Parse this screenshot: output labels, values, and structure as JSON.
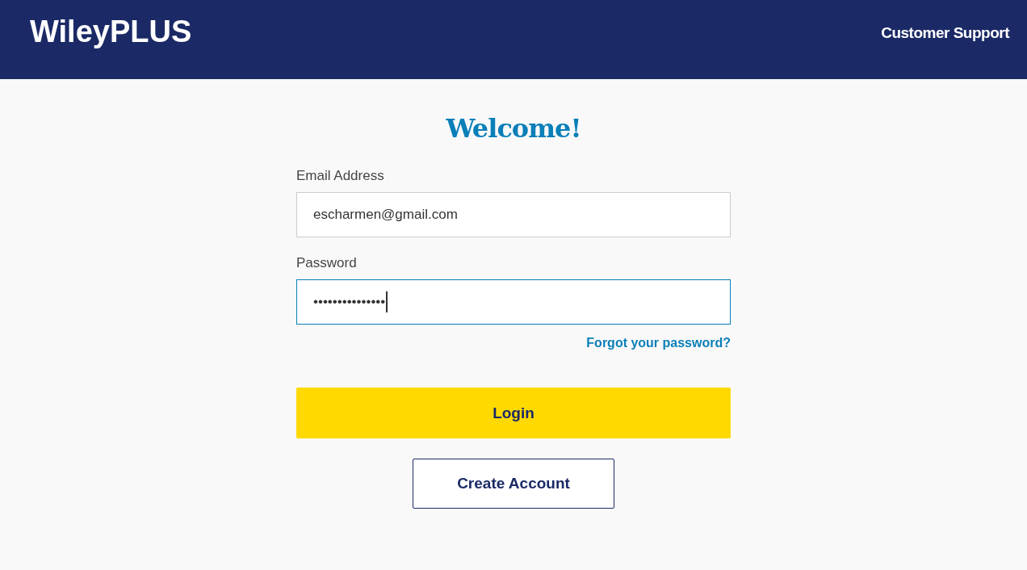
{
  "header": {
    "logo": "WileyPLUS",
    "support_link": "Customer Support"
  },
  "title": "Welcome!",
  "fields": [
    {
      "label": "Email Address",
      "value": "escharmen@gmail.com",
      "focused": false
    },
    {
      "label": "Password",
      "value": "•••••••••••••••",
      "focused": true
    }
  ],
  "forgot_link": "Forgot your password?",
  "login_button": "Login",
  "create_button": "Create Account"
}
